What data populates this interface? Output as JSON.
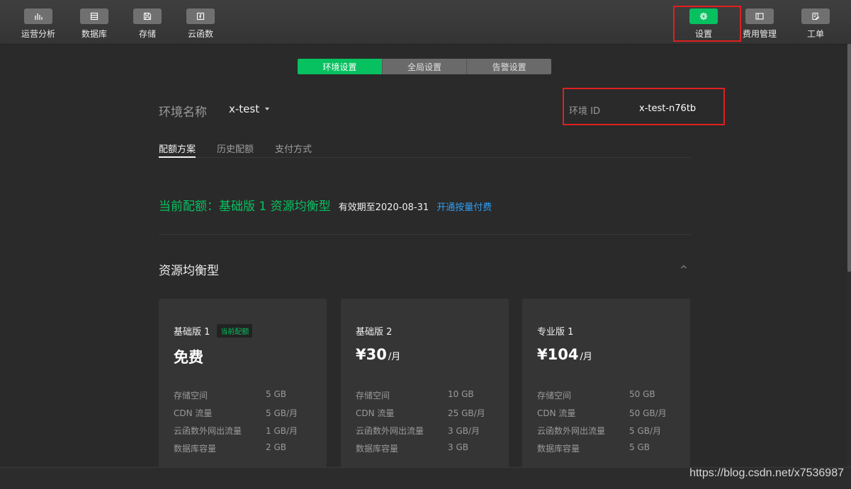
{
  "toolbar": {
    "left_items": [
      {
        "label": "运营分析",
        "icon": "bar-chart-icon"
      },
      {
        "label": "数据库",
        "icon": "database-icon"
      },
      {
        "label": "存储",
        "icon": "storage-icon"
      },
      {
        "label": "云函数",
        "icon": "function-icon"
      }
    ],
    "right_items": [
      {
        "label": "设置",
        "icon": "gear-icon",
        "active": true
      },
      {
        "label": "费用管理",
        "icon": "billing-icon"
      },
      {
        "label": "工单",
        "icon": "ticket-icon"
      }
    ]
  },
  "settings_tabs": [
    "环境设置",
    "全局设置",
    "告警设置"
  ],
  "env": {
    "name_label": "环境名称",
    "name_value": "x-test",
    "id_label": "环境 ID",
    "id_value": "x-test-n76tb"
  },
  "sub_tabs": [
    "配额方案",
    "历史配额",
    "支付方式"
  ],
  "quota": {
    "current": "当前配额：基础版 1 资源均衡型",
    "expire": "有效期至2020-08-31",
    "link": "开通按量付费"
  },
  "section_title": "资源均衡型",
  "plans": [
    {
      "name": "基础版 1",
      "badge": "当前配额",
      "price": "免费",
      "unit": "",
      "specs": [
        {
          "label": "存储空间",
          "value": "5 GB"
        },
        {
          "label": "CDN 流量",
          "value": "5 GB/月"
        },
        {
          "label": "云函数外网出流量",
          "value": "1 GB/月"
        },
        {
          "label": "数据库容量",
          "value": "2 GB"
        }
      ]
    },
    {
      "name": "基础版 2",
      "badge": "",
      "price": "¥30",
      "unit": "/月",
      "specs": [
        {
          "label": "存储空间",
          "value": "10 GB"
        },
        {
          "label": "CDN 流量",
          "value": "25 GB/月"
        },
        {
          "label": "云函数外网出流量",
          "value": "3 GB/月"
        },
        {
          "label": "数据库容量",
          "value": "3 GB"
        }
      ]
    },
    {
      "name": "专业版 1",
      "badge": "",
      "price": "¥104",
      "unit": "/月",
      "specs": [
        {
          "label": "存储空间",
          "value": "50 GB"
        },
        {
          "label": "CDN 流量",
          "value": "50 GB/月"
        },
        {
          "label": "云函数外网出流量",
          "value": "5 GB/月"
        },
        {
          "label": "数据库容量",
          "value": "5 GB"
        }
      ]
    }
  ],
  "watermark": "https://blog.csdn.net/x7536987",
  "colors": {
    "accent": "#07c160",
    "link": "#2f9df3",
    "highlight": "#e02020"
  }
}
